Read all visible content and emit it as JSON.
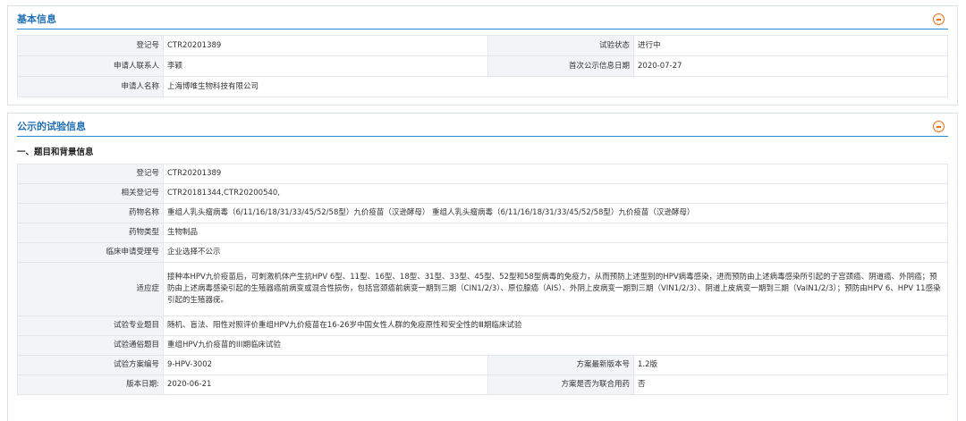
{
  "basic_info": {
    "title": "基本信息",
    "fields": {
      "reg_no_label": "登记号",
      "reg_no": "CTR20201389",
      "status_label": "试验状态",
      "status": "进行中",
      "contact_label": "申请人联系人",
      "contact": "李颖",
      "first_pub_label": "首次公示信息日期",
      "first_pub": "2020-07-27",
      "applicant_label": "申请人名称",
      "applicant": "上海博唯生物科技有限公司"
    }
  },
  "public_info": {
    "title": "公示的试验信息",
    "section_heading": "一、题目和背景信息",
    "fields": {
      "reg_no_label": "登记号",
      "reg_no": "CTR20201389",
      "related_label": "相关登记号",
      "related": "CTR20181344,CTR20200540,",
      "drug_name_label": "药物名称",
      "drug_name": "重组人乳头瘤病毒（6/11/16/18/31/33/45/52/58型）九价疫苗（汉逊酵母） 重组人乳头瘤病毒（6/11/16/18/31/33/45/52/58型）九价疫苗（汉逊酵母）",
      "drug_type_label": "药物类型",
      "drug_type": "生物制品",
      "accept_no_label": "临床申请受理号",
      "accept_no": "企业选择不公示",
      "indication_label": "适应症",
      "indication": "接种本HPV九价疫苗后，可刺激机体产生抗HPV 6型、11型、16型、18型、31型、33型、45型、52型和58型病毒的免疫力，从而预防上述型别的HPV病毒感染，进而预防由上述病毒感染所引起的子宫颈癌、阴道癌、外阴癌；预防由上述病毒感染引起的生殖器癌前病变或混合性损伤，包括宫颈癌前病变一期到三期（CIN1/2/3）、原位腺癌（AIS）、外阴上皮病变一期到三期（VIN1/2/3）、阴道上皮病变一期到三期（VaIN1/2/3）；预防由HPV 6、HPV 11感染引起的生殖器疣。",
      "pro_title_label": "试验专业题目",
      "pro_title": "随机、盲法、阳性对照评价重组HPV九价疫苗在16-26岁中国女性人群的免疫原性和安全性的Ⅲ期临床试验",
      "popular_title_label": "试验通俗题目",
      "popular_title": "重组HPV九价疫苗的III期临床试验",
      "protocol_no_label": "试验方案编号",
      "protocol_no": "9-HPV-3002",
      "latest_version_label": "方案最新版本号",
      "latest_version": "1.2版",
      "version_date_label": "版本日期:",
      "version_date": "2020-06-21",
      "combo_label": "方案是否为联合用药",
      "combo": "否"
    }
  }
}
